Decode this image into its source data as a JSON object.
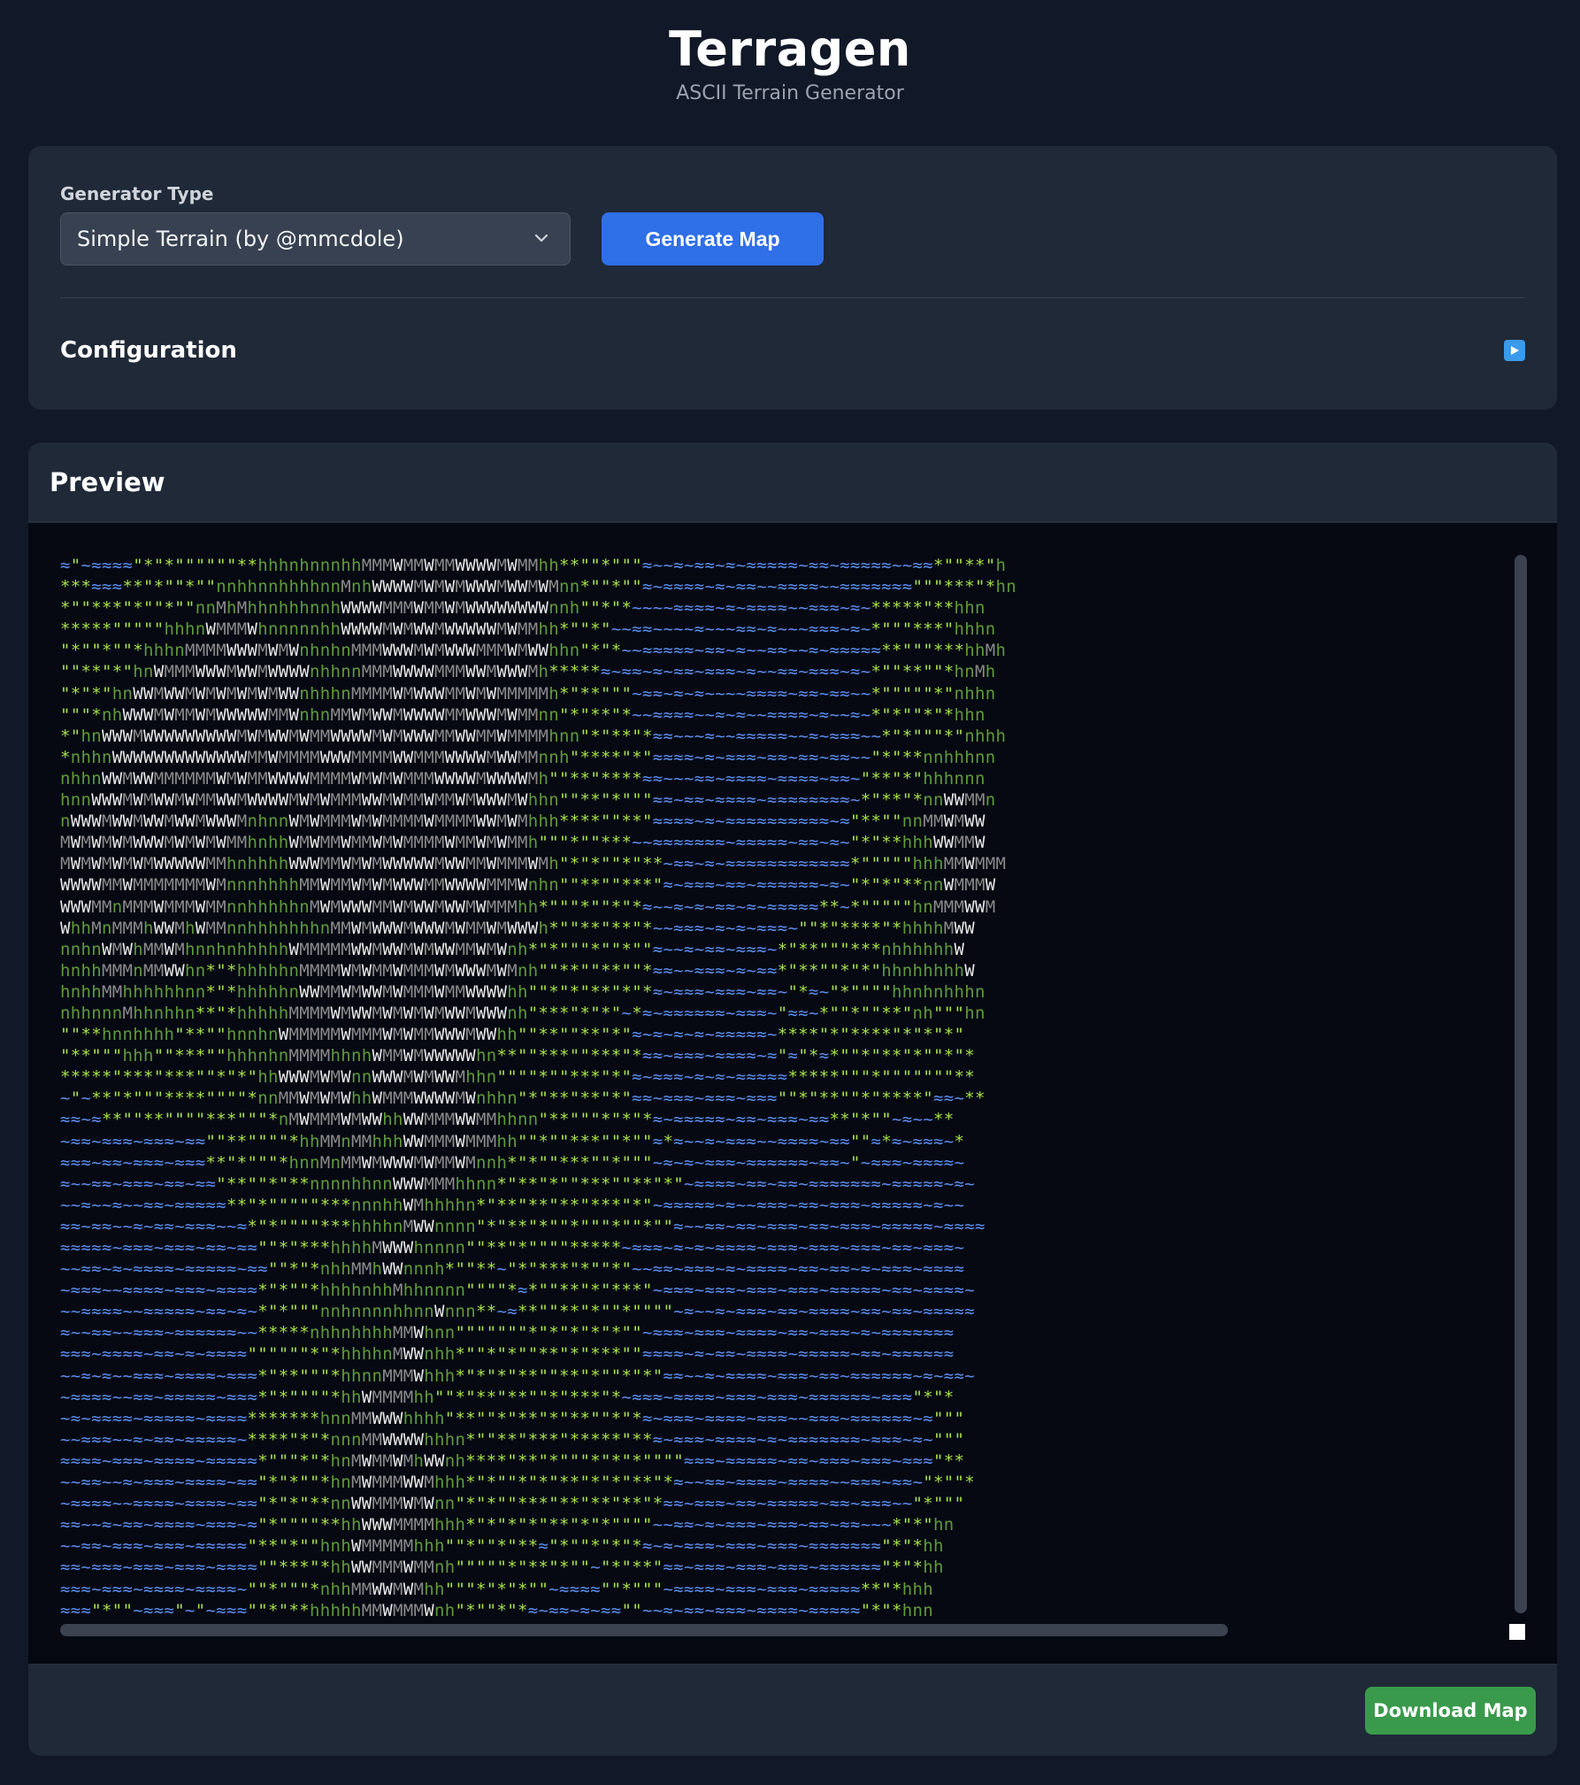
{
  "app": {
    "title": "Terragen",
    "subtitle": "ASCII Terrain Generator"
  },
  "controls": {
    "generator_type_label": "Generator Type",
    "selected_generator": "Simple Terrain (by @mmcdole)",
    "generate_button": "Generate Map",
    "configuration_label": "Configuration",
    "configuration_toggle_icon": "play-icon"
  },
  "preview": {
    "title": "Preview",
    "download_button": "Download Map",
    "legend_colors": {
      "water": "#5b8def",
      "sand": "#a6e04a",
      "grass": "#5f9a3c",
      "hills": "#8a8a8a",
      "mountain": "#e8e8e8",
      "background": "#060912"
    },
    "map_lines": [
      "≈\"~≈≈≈≈\"*\"*\"\"\"\"\"\"**hhhnhnnnhhMMMWMMWMMWWWWMWMMhh**\"\"*\"\"\"≈~~≈~≈≈~≈~≈≈≈≈≈~≈≈~≈≈≈≈≈~~≈≈*\"\"**\"h",
      "***≈≈≈**\"*\"\"*\"\"nnhhnnhhhhnnMnhWWWWMWMWMWWWMWWMWMnn*\"\"*\"\"≈~≈≈≈≈~≈~≈≈~~≈≈≈≈~~≈≈≈≈≈≈≈\"\"\"***\"*hn",
      "*\"\"***\"*\"\"*\"\"nnMhMhhnhhhnnhWWWWMMMWMMWMWWWWWWWWnnh\"\"*\"*~~~~≈≈≈≈~≈~≈≈≈≈~~≈≈≈~≈~*****\"**hhn",
      "*****\"\"\"\"\"hhhnWMMMWhnnnnnhhWWWWMWMWWMWWWWWMWMMhh*\"\"*\"~~≈≈~~~~≈~~~≈≈~≈~~~≈≈≈~≈~*\"\"\"***\"hhhn",
      "\"*\"\"*\"\"*hhhnMMMMWWWMWMWnhnhnMMMWWWMWMWWWMMMWMWWhhn\"*\"*~~≈≈≈≈≈~≈≈~≈~~≈≈~~≈~≈≈≈≈≈**\"\"\"***hhMh",
      "\"\"**\"*\"hnWMMMWWWMWWMWWWWnhhnnMMMWWWWMMMWWMWWWMh*****≈~≈≈~≈~≈≈~≈≈≈~≈~~≈≈~≈≈≈~≈~*\"\"**\"\"*hnMh",
      "\"*\"*\"hnWWMWWMWMWMWMWMWWnhhhnMMMMWMWWWMMWMWMMMMMh*\"**\"\"\"~≈≈~≈~≈~~~~≈≈≈≈~≈≈~≈≈~~*\"\"\"\"\"*\"nhhn",
      "\"\"\"*nhWWWMWMMWMWWWWWMMWnhnMMWMWWMWWWWMMWWWMWMMnn\"*\"**\"*~~≈≈≈≈~~≈~≈~~≈≈≈≈~≈~~≈~*\"*\"\"*\"*hhn",
      "*\"hnWWWMWWWWWWWWWMWMWWMWMMWWWWMWMWWWMMWWMMWMMMMhnn\"*\"**\"*≈≈~~~≈~~≈≈≈≈≈~~≈~≈≈≈~~*\"*\"\"\"*\"nhhh",
      "*nhhnWWWWWWWWWWWWWMMWMMMMWWWMMMMWWMMMWWWWMWWMMnnh\"****\"*\"≈≈≈≈~≈~≈≈≈~≈≈~≈≈~≈≈~~\"*\"**nnhhhnn",
      "nhhnWWMWWMMMMMMWMWMMWWWWMMMMWMWMWMMMWWWWMWWWWMh\"\"**\"****≈≈~~~≈≈~≈≈≈≈~≈≈≈≈~≈≈~\"**\"*\"hhhnnn",
      "hnnWWWMWMWWMWMMWWMWWWWMWMWMMMWWMWMMWMMWMWWWMWhhn\"\"**\"*\"\"\"≈≈~≈≈~≈≈≈≈~≈≈≈≈≈≈≈≈~*\"**\"*nnWWMMn",
      "nWWWMWWMWWMWWMWWWMnhnnWMWMMMWMWMMMMWMMMMWWMWMhhh****\"\"**\"≈≈≈≈~≈~≈≈≈≈≈≈≈≈≈≈~≈\"**\"\"nnMMWMWW",
      "MWMWMWMWWWMWMWMWMMhnhhWMWMMWMMWMWMMMMWMMWMWMMh\"\"\"*\"\"***~~≈≈≈≈≈≈≈~≈≈≈≈≈~≈≈~≈~\"*\"**hhhWWMMW",
      "MWMWMWMWMWWWWWMMhnhhhhWWWMMWMWMWWWWWMWWMMWMMMWMh\"*\"*\"\"*\"**~≈≈~≈~≈≈≈≈≈≈≈≈≈≈≈≈*\"\"\"\"\"hhhMMWMMM",
      "WWWWMMWMMMMMMMWMnnnhhhhMMWMMWMWMWWWMMWWWWMMMWnhn\"\"**\"\"***\"≈~≈≈≈~≈≈~≈≈≈≈≈≈~≈~\"*\"*\"**nnWMMMW",
      "WWWMMnMMMWMMMWMMnnhhhhhnMWMWWWMMWMWWMWWMWMMMhh*\"\"\"*\"\"*\"*≈~~≈~≈~≈≈~≈~≈≈≈≈≈**~*\"\"\"\"\"hnMMMWWM",
      "WhhMnMMMhWWMhWMMnnhhhhhhhnMMWMWWWMWWWMWMMWMWWWh*\"\"**\"**\"*~~≈≈≈~≈~≈~≈≈≈~\"\"*\"****\"*hhhhMWW",
      "nnhnWMWhMMWMhnnhnhhhhhWMMMMMWWMWWMWMWWMMWMWnh*\"*\"\"\"*\"\"*\"\"≈~~≈~≈≈~≈≈≈~*\"**\"\"\"***nhhhhhhW",
      "hnhhMMMnMMWWhn*\"*hhhhhnMMMMWMWMMWMMMWMWWWMWMnh\"\"**\"\"**\"\"*≈≈~~≈≈≈~≈~≈≈*\"**\"\"*\"*\"hhnhhhhhW",
      "hnhhMMhhhhhhnn*\"*hhhhhnWWMMWMWWMWMMMWMMWWWWhh\"\"*\"*\"**\"*\"*≈~≈≈≈~≈≈≈~≈≈~\"*≈~\"*\"\"\"\"hhnhnhhhn",
      "nhhnnnMhhnhhn**\"*hhhhhMMMMWMWWMWMWMWMWWMWWWnh\"***\"*\"*\"~*≈~≈≈≈≈≈≈~≈≈≈~\"≈≈~*\"\"*\"\"**\"nh\"\"\"hn",
      "\"\"**hnnhhhh\"**\"\"hnnhnWMMMMMWMMMWMWMMWWWMWWhh\"\"**\"\"**\"*\"≈~≈~≈~≈~≈≈≈≈≈~****\"*\"****\"*\"*\"*\"",
      "\"**\"\"\"hhh\"\"***\"\"hhhnhnMMMMhhnhWMMWMWWWWWhn**\"\"***\"\"***\"*≈≈~≈≈≈~≈≈≈≈~≈\"≈\"*≈*\"\"*\"**\"*\"\"*\"*",
      "*****\"***\"***\"\"*\"*\"hhWWWMWMWnnWWWMWMWWMhhn\"\"\"\"*\"\"***\"*\"≈~≈≈≈~≈~≈~≈≈≈≈≈*****\"\"\"*\"\"\"\"\"\"\"**",
      "~\"~**\"*\"\"\"****\"\"\"\"*nnMMWMWMWhhWMMMWWWWMWnhhn\"*\"**\"**\"*\"≈≈~≈≈≈~≈≈≈~≈≈≈\"\"*\"**\"\"*\"****\"≈≈~**",
      "≈≈~≈**\"\"**\"\"\"\"***\"\"\"*nMWMMMWMWWhhWWMMMWWMMhhnn\"**\"\"\"*\"*\"*≈~≈≈≈≈≈~≈≈~≈≈≈~≈≈**\"*\"\"~≈~~**",
      "~≈≈~≈≈≈~≈≈≈~≈≈\"\"**\"\"\"\"*hhMMnMMhhhWWMMMWMMMhh\"\"*\"\"***\"\"*\"\"≈*≈~~≈~≈≈≈~~≈≈≈≈~≈≈\"\"≈*≈~≈≈≈~*",
      "≈≈≈~≈≈~≈≈≈~≈≈≈**\"*\"\"\"*hnnMnMMWMWWWMWMMWMnnh*\"*\"\"***\"\"*\"\"\"~≈~≈~≈≈≈~≈≈≈≈≈≈~≈≈~\"~≈≈≈~≈≈≈≈~",
      "≈~~≈≈~≈≈≈~≈≈~≈≈\"**\"\"*\"**nnnnhhnnWWWMMMhhnn*\"**\"*\"\"***\"\"**\"*\"~≈≈≈≈~≈≈~≈≈~≈≈≈≈≈≈≈~≈≈≈≈≈~≈~",
      "~~≈~~≈~~≈≈~≈≈≈≈≈**\"*\"\"\"\"\"***nnnhhWMhhhhn*\"**\"**\"**\"***\"*\"~≈≈≈≈≈~≈~~≈≈≈~≈≈~≈≈≈~≈≈≈≈≈~≈~~",
      "≈≈~≈≈~~≈~≈≈~≈≈≈~~≈*\"*\"\"\"\"***hhhhnMWWnnnn\"*\"**\"*\"\"*\"\"\"*\"\"*\"\"≈~~≈≈~≈≈~≈≈≈~≈≈~≈≈≈~≈≈≈≈≈~≈≈≈≈",
      "≈≈≈≈≈~≈≈≈~≈≈≈~≈≈~≈≈\"\"*\"***hhhhMWWWhnnnn\"\"**\"*\"\"\"\"*****~≈≈≈~≈~≈~≈≈≈≈~≈≈≈~≈≈≈~≈≈≈~≈≈~≈≈≈~",
      "~~≈≈~≈~≈≈≈≈~≈≈≈≈≈~≈≈\"\"*\"*nhhMMhWWnnnh*\"\"**~\"*\"***\"*\"\"*\"~~≈≈~≈≈≈~≈~≈≈≈≈~≈≈~≈≈~≈~≈≈≈~≈≈≈≈",
      "~≈≈≈~~≈≈≈≈~≈≈≈~≈≈≈≈*\"*\"\"*hhhhnhhMhhnnnn\"\"\"\"*≈*\"\"**\"*\"***\"~≈≈≈~≈≈≈~≈≈≈~≈≈≈~≈≈≈≈≈~≈≈~≈≈≈≈~",
      "~~≈≈≈≈~~≈≈≈≈≈~≈≈~≈~*\"*\"\"\"nnhnnnnhhnnWnnn**~≈**\"\"**\"*\"\"*\"\"\"\"~≈~~≈~≈≈≈~≈≈~≈≈≈≈~≈≈~≈≈~≈≈≈≈≈",
      "≈~~≈≈~~≈≈≈~≈≈≈≈≈≈~~*****nhhnhhhhMMWhnn\"\"\"\"\"\"\"*\"*\"*\"*\"*\"\"~≈≈≈~≈≈≈~≈≈≈≈~≈≈~≈≈≈~≈~≈≈≈≈≈≈≈",
      "≈≈≈~≈≈≈≈~≈≈~≈~≈≈≈≈\"\"\"\"\"\"*\"*hhhhnMWWnhh*\"\"*\"*\"\"**\"*\"***\"\"≈≈≈≈~≈~≈≈~≈≈≈≈~≈≈≈≈≈~≈≈~≈≈≈≈≈≈",
      "~~≈~≈~~≈≈≈~≈≈≈≈~≈≈≈*\"**\"\"\"*hhnnMMMWhhh*\"*\"*\"**\"\"**\"*\"\"*\"*\"≈≈~~≈~≈≈≈≈~≈≈≈~≈≈~≈≈≈≈≈≈~≈~≈≈~",
      "~≈≈≈≈~~≈≈~≈≈≈≈≈~≈≈≈*\"*\"\"\"\"*hhWMMMMhh\"\"*\"**\"**\"\"*\"***\"*~≈≈≈~≈≈≈≈~≈≈≈~≈≈≈~≈≈≈≈≈≈~≈≈≈\"*\"*",
      "~≈~≈≈≈≈~≈≈≈≈≈~≈≈≈≈*******hnnMMWWWhhhh\"**\"\"*\"**\"*\"**\"\"*\"*≈~≈≈≈~≈≈≈≈~≈≈≈~~≈≈≈~≈≈≈≈≈≈~≈\"\"\"",
      "~~≈≈≈~~≈~≈≈~≈≈≈≈≈~****\"*\"*nnnMMWWWWhhhn*\"\"**\"***\"*****\"**≈~≈≈≈~≈≈≈≈~≈~≈≈≈≈≈≈≈~≈≈≈~≈~\"\"\"",
      "≈≈≈≈~≈≈≈~≈≈≈≈~≈≈≈≈≈*\"\"\"*\"*hnMWMMWMhWWnh****\"**\"*\"\"\"*\"*\"*\"\"\"\"≈≈≈~≈≈≈≈≈~≈≈~≈≈≈~≈≈≈~≈≈≈\"**",
      "~~≈≈~~≈~≈≈≈~≈≈≈≈~≈≈\"*\"*\"\"*hnMWMMMWWMhhh*\"*\"\"*\"*\"**\"*\"*\"**\"*≈~~≈≈~≈≈≈≈~≈≈≈≈~~≈≈≈~≈≈~\"*\"\"*",
      "~≈≈≈≈~~≈≈≈≈~≈≈≈≈~≈≈\"*\"*\"**nnWWMMMWMWnn\"*\"*\"\"***\"**\"**\"**\"*≈≈~≈≈≈~≈≈~≈≈≈≈≈~≈≈~≈≈≈~~\"*\"\"\"",
      "≈≈~~≈~≈≈~≈≈≈≈~≈≈≈~≈\"*\"\"\"\"**hhWWWMMMMhhh*\"*\"*\"*\"**\"*\"*\"\"\"\"~~≈≈~≈~≈≈≈~≈≈≈~≈≈~≈≈~~~*\"*\"hn",
      "~~≈≈~≈≈≈~≈≈≈~≈≈≈≈≈\"**\"*\"\"hnhWMMMMMhhh\"\"*\"\"*\"**≈\"*\"\"*\"*\"*≈~≈~≈≈≈~≈≈≈~≈≈≈~≈≈≈≈≈≈≈\"*\"*hh",
      "≈≈~≈≈≈~≈≈≈~≈≈≈~≈≈≈≈\"\"***\"*hhWWMMMWMMnh\"\"\"\"\"*\"**\"*\"\"~\"*\"**\"≈≈~≈≈≈~≈≈≈~≈≈≈~≈≈≈≈≈≈\"*\"*hh",
      "≈≈≈~≈≈≈~≈≈≈≈~≈≈≈≈~\"\"*\"\"\"*nhhMMWWMWMhh\"\"\"*\"*\"*\"\"~≈≈≈≈\"\"*\"\"\"~≈≈≈≈~≈≈≈~≈≈≈~≈≈≈≈≈**\"*hhh",
      "≈≈≈\"*\"\"~≈≈≈\"~\"~≈≈≈\"\"*\"**hhhhhMMWMMMWnh\"*\"\"*\"*≈~≈≈~≈~≈≈\"\"~~≈~≈≈~≈≈≈~≈≈≈≈~≈≈≈≈≈\"*\"*hnn"
    ]
  }
}
